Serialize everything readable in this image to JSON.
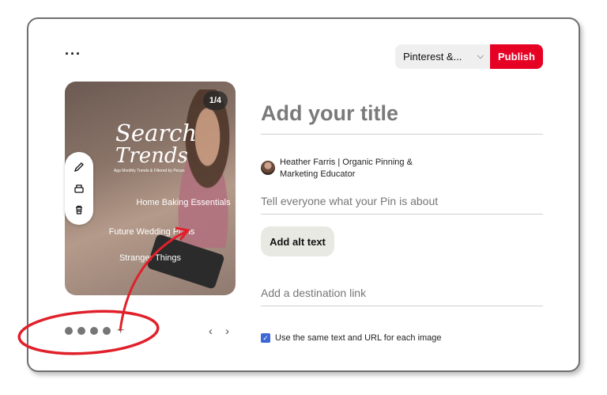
{
  "toolbar": {
    "more_label": "···",
    "board_select_value": "Pinterest &...",
    "board_chevron": "⌵",
    "publish_label": "Publish"
  },
  "image": {
    "counter": "1/4",
    "title_line1": "Search",
    "title_line2": "Trends",
    "subtitle": "App Monthly Trends & Filtered by Pecan",
    "lines": [
      "Home Baking Essentials",
      "Future Wedding Plans",
      "Stranger Things"
    ]
  },
  "image_tools": [
    "pencil-icon",
    "crop-icon",
    "trash-icon"
  ],
  "carousel": {
    "dot_count": 4,
    "add_label": "+",
    "prev_label": "‹",
    "next_label": "›"
  },
  "form": {
    "title_placeholder": "Add your title",
    "author_name": "Heather Farris | Organic Pinning & Marketing Educator",
    "description_placeholder": "Tell everyone what your Pin is about",
    "alt_text_label": "Add alt text",
    "link_placeholder": "Add a destination link",
    "same_text_checked": true,
    "same_text_label": "Use the same text and URL for each image"
  },
  "colors": {
    "publish": "#e60023",
    "checkbox": "#3e67d6",
    "annotation": "#e0202a"
  }
}
